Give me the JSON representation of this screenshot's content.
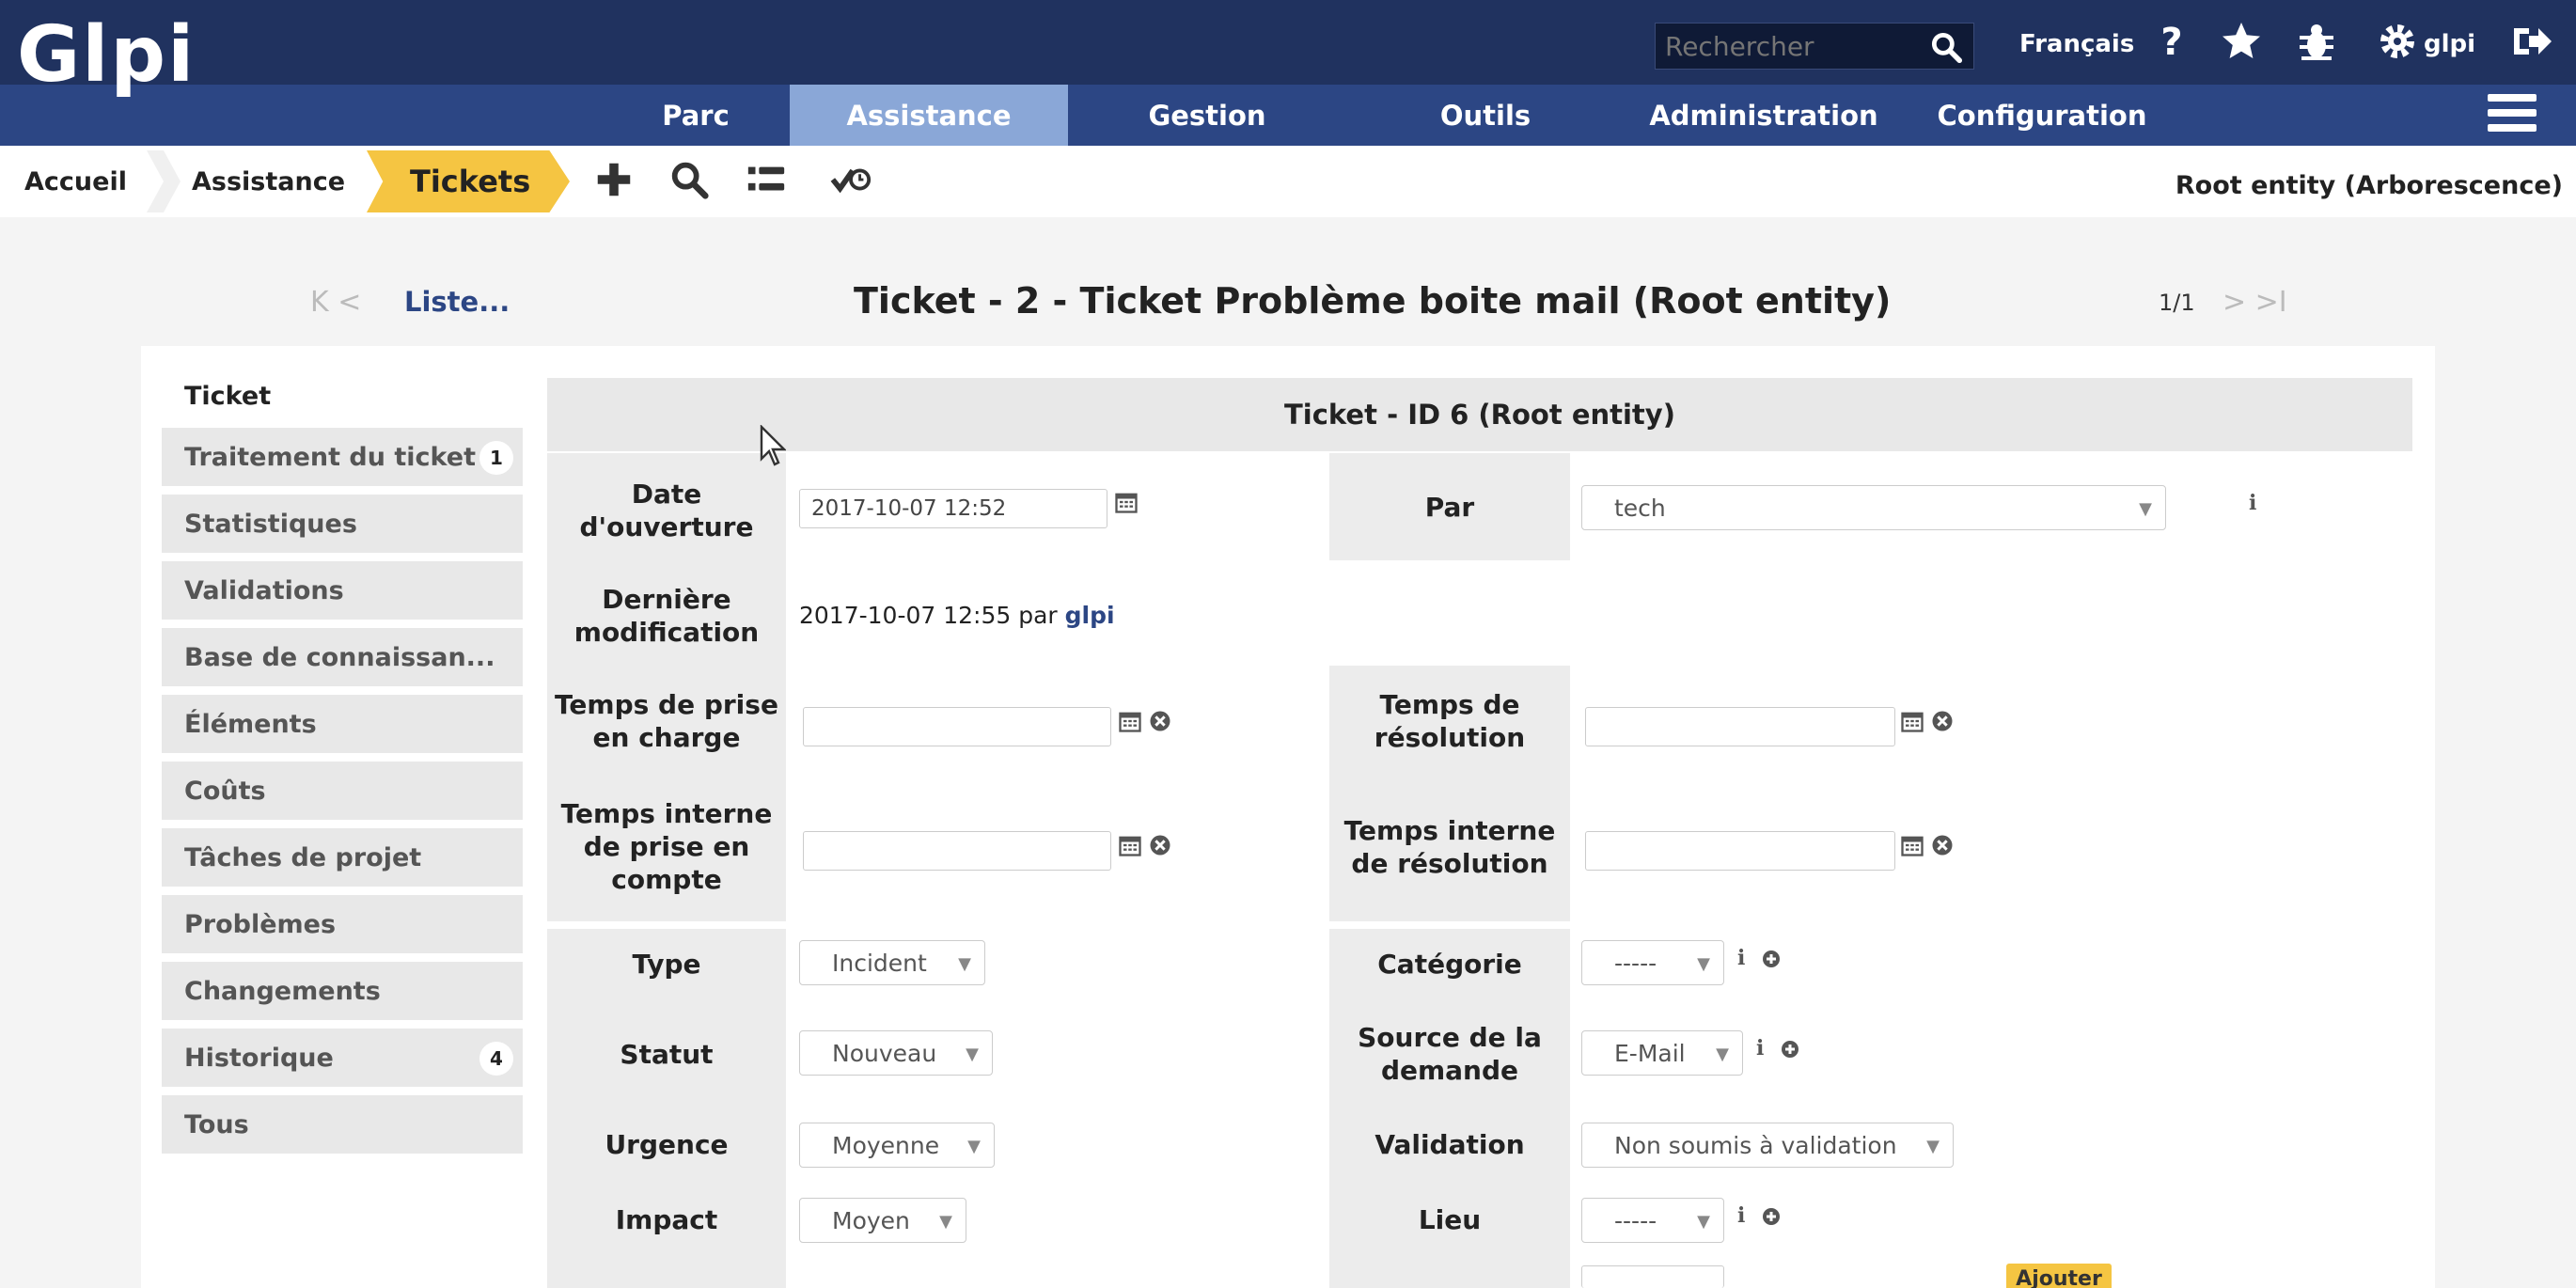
{
  "brand": {
    "logo_text": "Glpi"
  },
  "search": {
    "placeholder": "Rechercher"
  },
  "topbar": {
    "language": "Français",
    "user": "glpi"
  },
  "menu": {
    "items": [
      "Parc",
      "Assistance",
      "Gestion",
      "Outils",
      "Administration",
      "Configuration"
    ],
    "active": "Assistance"
  },
  "breadcrumb": {
    "home": "Accueil",
    "section": "Assistance",
    "current": "Tickets"
  },
  "entity_label": "Root entity (Arborescence)",
  "page": {
    "nav_prev": "K <",
    "list_link": "Liste...",
    "title": "Ticket - 2 - Ticket Problème boite mail (Root entity)",
    "counter": "1/1",
    "nav_next": "> >I"
  },
  "tabs": [
    {
      "label": "Ticket"
    },
    {
      "label": "Traitement du ticket",
      "badge": "1"
    },
    {
      "label": "Statistiques"
    },
    {
      "label": "Validations"
    },
    {
      "label": "Base de connaissan..."
    },
    {
      "label": "Éléments"
    },
    {
      "label": "Coûts"
    },
    {
      "label": "Tâches de projet"
    },
    {
      "label": "Problèmes"
    },
    {
      "label": "Changements"
    },
    {
      "label": "Historique",
      "badge": "4"
    },
    {
      "label": "Tous"
    }
  ],
  "form": {
    "header": "Ticket - ID 6 (Root entity)",
    "date_opening_label": "Date\nd'ouverture",
    "date_opening_value": "2017-10-07 12:52",
    "by_label": "Par",
    "by_value": "tech",
    "last_mod_label": "Dernière\nmodification",
    "last_mod_value": "2017-10-07 12:55 par",
    "last_mod_user": "glpi",
    "tto_label": "Temps de prise\nen charge",
    "ttr_label": "Temps de\nrésolution",
    "internal_tto_label": "Temps interne\nde prise en\ncompte",
    "internal_ttr_label": "Temps interne\nde résolution",
    "type_label": "Type",
    "type_value": "Incident",
    "category_label": "Catégorie",
    "category_value": "-----",
    "status_label": "Statut",
    "status_value": "Nouveau",
    "source_label": "Source de la\ndemande",
    "source_value": "E-Mail",
    "urgency_label": "Urgence",
    "urgency_value": "Moyenne",
    "validation_label": "Validation",
    "validation_value": "Non soumis à validation",
    "impact_label": "Impact",
    "impact_value": "Moyen",
    "location_label": "Lieu",
    "location_value": "-----",
    "add_button": "Ajouter"
  },
  "colors": {
    "topbar": "#20325f",
    "menubar": "#2c4684",
    "active_menu": "#8aa7d7",
    "accent": "#f5c542"
  }
}
